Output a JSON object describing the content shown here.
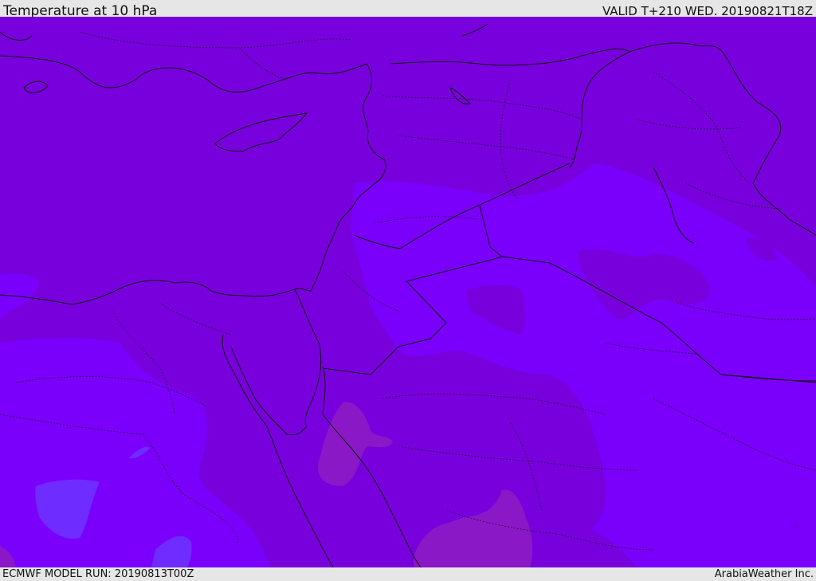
{
  "header": {
    "title": "Temperature at 10 hPa",
    "valid_time": "VALID T+210 WED. 20190821T18Z"
  },
  "footer": {
    "model_run": "ECMWF MODEL RUN: 20190813T00Z",
    "credit": "ArabiaWeather Inc."
  },
  "map": {
    "colors": {
      "darker_band": "#7a00d4",
      "base_band": "#7800dd",
      "light_band": "#7a00fb",
      "lighter_patch": "#6f2cff",
      "warm_patch": "#8a18c6",
      "border_line": "#111111"
    }
  }
}
